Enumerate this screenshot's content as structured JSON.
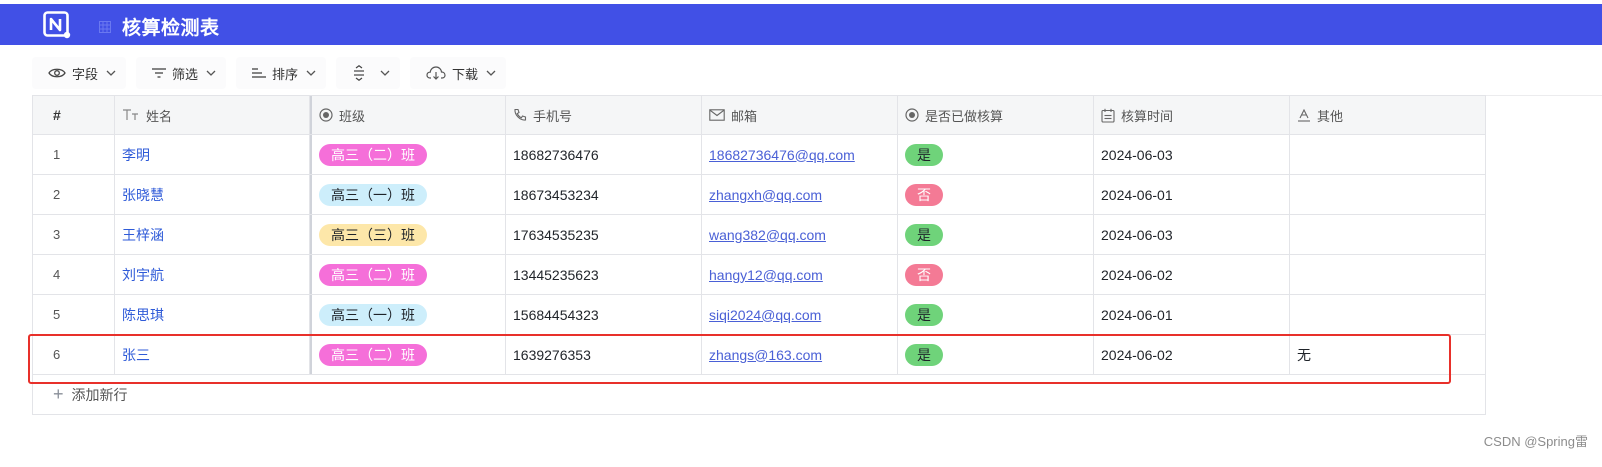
{
  "app": {
    "title": "核算检测表",
    "colors": {
      "appbar": "#4150e6",
      "accent": "#2f5bd8",
      "highlight": "#e8302a"
    }
  },
  "toolbar": {
    "fields_label": "字段",
    "filter_label": "筛选",
    "sort_label": "排序",
    "download_label": "下载"
  },
  "table": {
    "headers": {
      "index": "#",
      "name": "姓名",
      "class": "班级",
      "phone": "手机号",
      "email": "邮箱",
      "done": "是否已做核算",
      "time": "核算时间",
      "other": "其他"
    },
    "rows": [
      {
        "index": "1",
        "name": "李明",
        "class": "高三（二）班",
        "phone": "18682736476",
        "email": "18682736476@qq.com",
        "done": "是",
        "time": "2024-06-03",
        "other": ""
      },
      {
        "index": "2",
        "name": "张晓慧",
        "class": "高三（一）班",
        "phone": "18673453234",
        "email": "zhangxh@qq.com",
        "done": "否",
        "time": "2024-06-01",
        "other": ""
      },
      {
        "index": "3",
        "name": "王梓涵",
        "class": "高三（三）班",
        "phone": "17634535235",
        "email": "wang382@qq.com",
        "done": "是",
        "time": "2024-06-03",
        "other": ""
      },
      {
        "index": "4",
        "name": "刘宇航",
        "class": "高三（二）班",
        "phone": "13445235623",
        "email": "hangy12@qq.com",
        "done": "否",
        "time": "2024-06-02",
        "other": ""
      },
      {
        "index": "5",
        "name": "陈思琪",
        "class": "高三（一）班",
        "phone": "15684454323",
        "email": "siqi2024@qq.com",
        "done": "是",
        "time": "2024-06-01",
        "other": ""
      },
      {
        "index": "6",
        "name": "张三",
        "class": "高三（二）班",
        "phone": "1639276353",
        "email": "zhangs@163.com",
        "done": "是",
        "time": "2024-06-02",
        "other": "无"
      }
    ],
    "add_row_label": "添加新行"
  },
  "class_colors": {
    "高三（二）班": {
      "bg": "#f56fd9",
      "fg": "#ffffff"
    },
    "高三（一）班": {
      "bg": "#cdeefb",
      "fg": "#1f2329"
    },
    "高三（三）班": {
      "bg": "#fde7a9",
      "fg": "#1f2329"
    }
  },
  "done_colors": {
    "是": {
      "bg": "#6fd37a",
      "fg": "#1f2329"
    },
    "否": {
      "bg": "#f47a95",
      "fg": "#ffffff"
    }
  },
  "watermark": "CSDN @Spring雷"
}
